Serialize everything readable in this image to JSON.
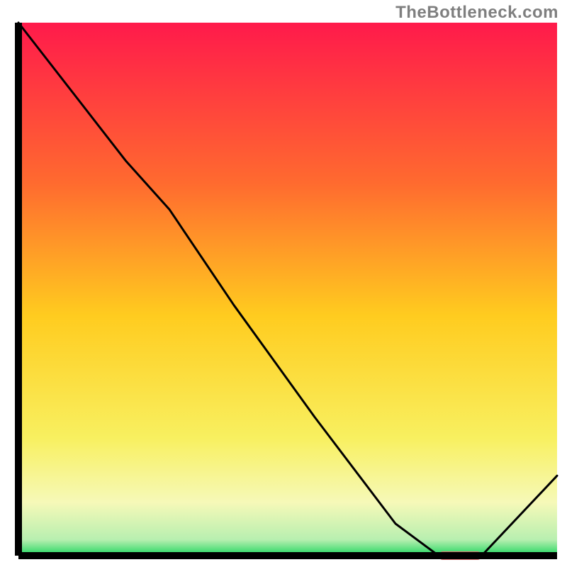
{
  "attribution": "TheBottleneck.com",
  "chart_data": {
    "type": "line",
    "title": "",
    "xlabel": "",
    "ylabel": "",
    "series": [
      {
        "name": "bottleneck-curve",
        "x": [
          0.0,
          0.1,
          0.2,
          0.28,
          0.4,
          0.55,
          0.7,
          0.78,
          0.82,
          0.86,
          1.0
        ],
        "values": [
          1.0,
          0.87,
          0.74,
          0.65,
          0.47,
          0.26,
          0.06,
          0.0,
          0.0,
          0.0,
          0.15
        ]
      }
    ],
    "xlim": [
      0,
      1
    ],
    "ylim": [
      0,
      1
    ],
    "marker": {
      "name": "highlight-marker",
      "x_range": [
        0.78,
        0.86
      ],
      "y": 0.0,
      "color": "#d46a6a"
    },
    "gradient_stops": [
      {
        "offset": 0.0,
        "color": "#ff1a4b"
      },
      {
        "offset": 0.3,
        "color": "#ff6a2f"
      },
      {
        "offset": 0.55,
        "color": "#ffcc1f"
      },
      {
        "offset": 0.78,
        "color": "#f8f060"
      },
      {
        "offset": 0.9,
        "color": "#f6f9b8"
      },
      {
        "offset": 0.97,
        "color": "#b8efb0"
      },
      {
        "offset": 1.0,
        "color": "#1fd65f"
      }
    ],
    "axis_color": "#000000",
    "line_color": "#000000",
    "line_width": 3.0
  }
}
